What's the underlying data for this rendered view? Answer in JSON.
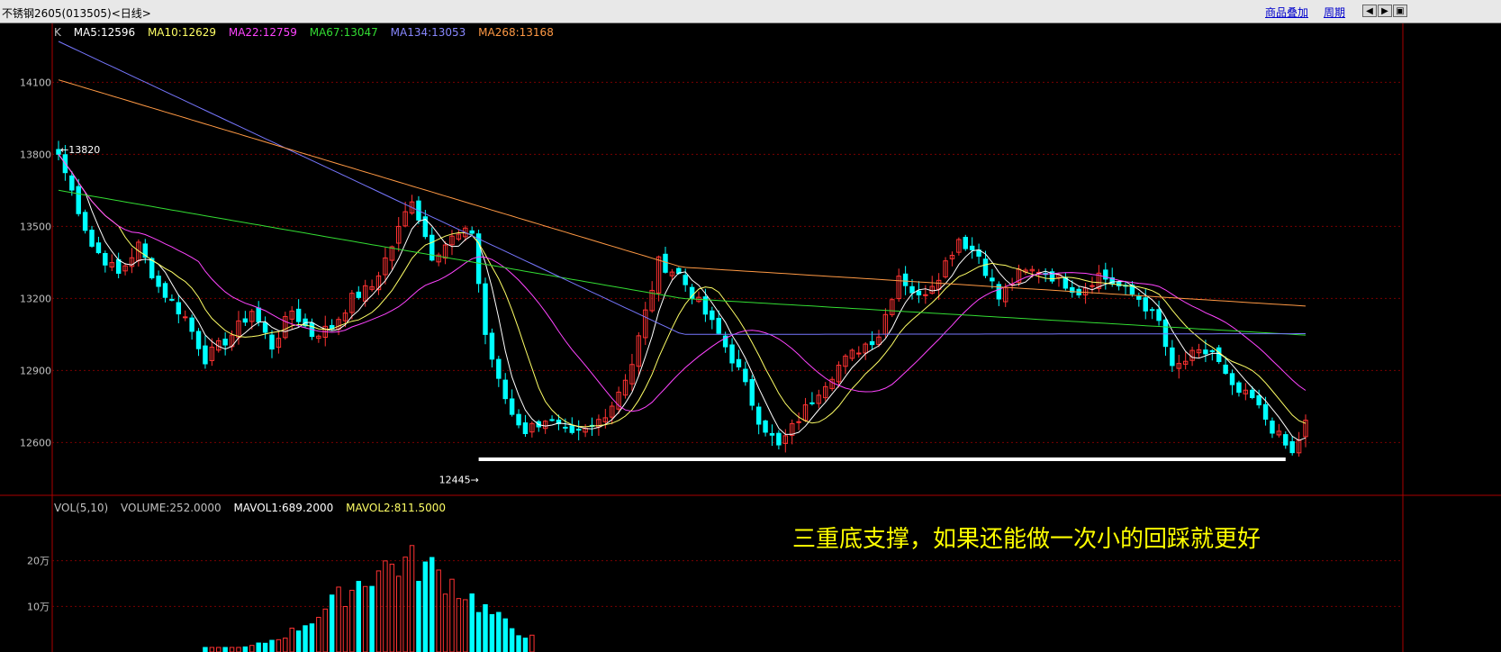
{
  "window": {
    "title": "不锈钢2605(013505)<日线>",
    "overlay_button": "商品叠加",
    "period_button": "周期"
  },
  "colors": {
    "background": "#000000",
    "up": "#ff3232",
    "down": "#00ffff",
    "ma5": "#ffffff",
    "ma10": "#ffff66",
    "ma22": "#ff44ff",
    "ma67": "#33dd33",
    "ma134": "#7777ff",
    "ma268": "#ff9944",
    "grid": "#7a0000",
    "axis": "#aa0000",
    "annotation": "#ffff00"
  },
  "price_legend": {
    "k": "K",
    "ma5": "MA5:12596",
    "ma10": "MA10:12629",
    "ma22": "MA22:12759",
    "ma67": "MA67:13047",
    "ma134": "MA134:13053",
    "ma268": "MA268:13168"
  },
  "volume_legend": {
    "label": "VOL(5,10)",
    "volume": "VOLUME:252.0000",
    "mavol1": "MAVOL1:689.2000",
    "mavol2": "MAVOL2:811.5000"
  },
  "annotation": "三重底支撑，如果还能做一次小的回踩就更好",
  "markers": {
    "high": "13820",
    "low": "12445"
  },
  "chart_data": {
    "type": "candlestick",
    "title": "不锈钢2605(013505)<日线>",
    "price_axis": {
      "ticks": [
        12600,
        12900,
        13200,
        13500,
        13800,
        14100
      ],
      "ylim": [
        12380,
        14330
      ]
    },
    "volume_axis": {
      "ticks": [
        100000,
        200000
      ],
      "tick_labels": [
        "10万",
        "20万"
      ],
      "ylim": [
        0,
        300000
      ]
    },
    "grid": true,
    "support_level": 12530,
    "high_marker": 13820,
    "low_marker": 12445,
    "anchors": [
      [
        0,
        13800
      ],
      [
        5,
        13420
      ],
      [
        9,
        13300
      ],
      [
        12,
        13420
      ],
      [
        15,
        13250
      ],
      [
        19,
        13120
      ],
      [
        22,
        12950
      ],
      [
        26,
        13050
      ],
      [
        29,
        13150
      ],
      [
        32,
        13000
      ],
      [
        35,
        13150
      ],
      [
        38,
        13050
      ],
      [
        41,
        13080
      ],
      [
        44,
        13200
      ],
      [
        47,
        13250
      ],
      [
        50,
        13420
      ],
      [
        53,
        13620
      ],
      [
        56,
        13380
      ],
      [
        59,
        13450
      ],
      [
        62,
        13480
      ],
      [
        64,
        13050
      ],
      [
        66,
        12850
      ],
      [
        68,
        12720
      ],
      [
        70,
        12650
      ],
      [
        73,
        12700
      ],
      [
        77,
        12620
      ],
      [
        80,
        12660
      ],
      [
        83,
        12760
      ],
      [
        86,
        12930
      ],
      [
        90,
        13350
      ],
      [
        93,
        13300
      ],
      [
        96,
        13180
      ],
      [
        99,
        13050
      ],
      [
        102,
        12900
      ],
      [
        105,
        12700
      ],
      [
        108,
        12580
      ],
      [
        111,
        12700
      ],
      [
        114,
        12820
      ],
      [
        117,
        12920
      ],
      [
        120,
        12990
      ],
      [
        123,
        13050
      ],
      [
        126,
        13300
      ],
      [
        129,
        13200
      ],
      [
        132,
        13300
      ],
      [
        135,
        13450
      ],
      [
        138,
        13380
      ],
      [
        141,
        13200
      ],
      [
        144,
        13300
      ],
      [
        147,
        13320
      ],
      [
        150,
        13280
      ],
      [
        153,
        13230
      ],
      [
        156,
        13300
      ],
      [
        159,
        13250
      ],
      [
        162,
        13200
      ],
      [
        165,
        13100
      ],
      [
        167,
        12900
      ],
      [
        170,
        12960
      ],
      [
        173,
        12980
      ],
      [
        176,
        12820
      ],
      [
        179,
        12780
      ],
      [
        182,
        12660
      ],
      [
        185,
        12550
      ],
      [
        187,
        12680
      ]
    ],
    "ma_current": {
      "MA5": 12596,
      "MA10": 12629,
      "MA22": 12759,
      "MA67": 13047,
      "MA134": 13053,
      "MA268": 13168
    },
    "volume_current": {
      "VOLUME": 252.0,
      "MAVOL1": 689.2,
      "MAVOL2": 811.5
    }
  }
}
